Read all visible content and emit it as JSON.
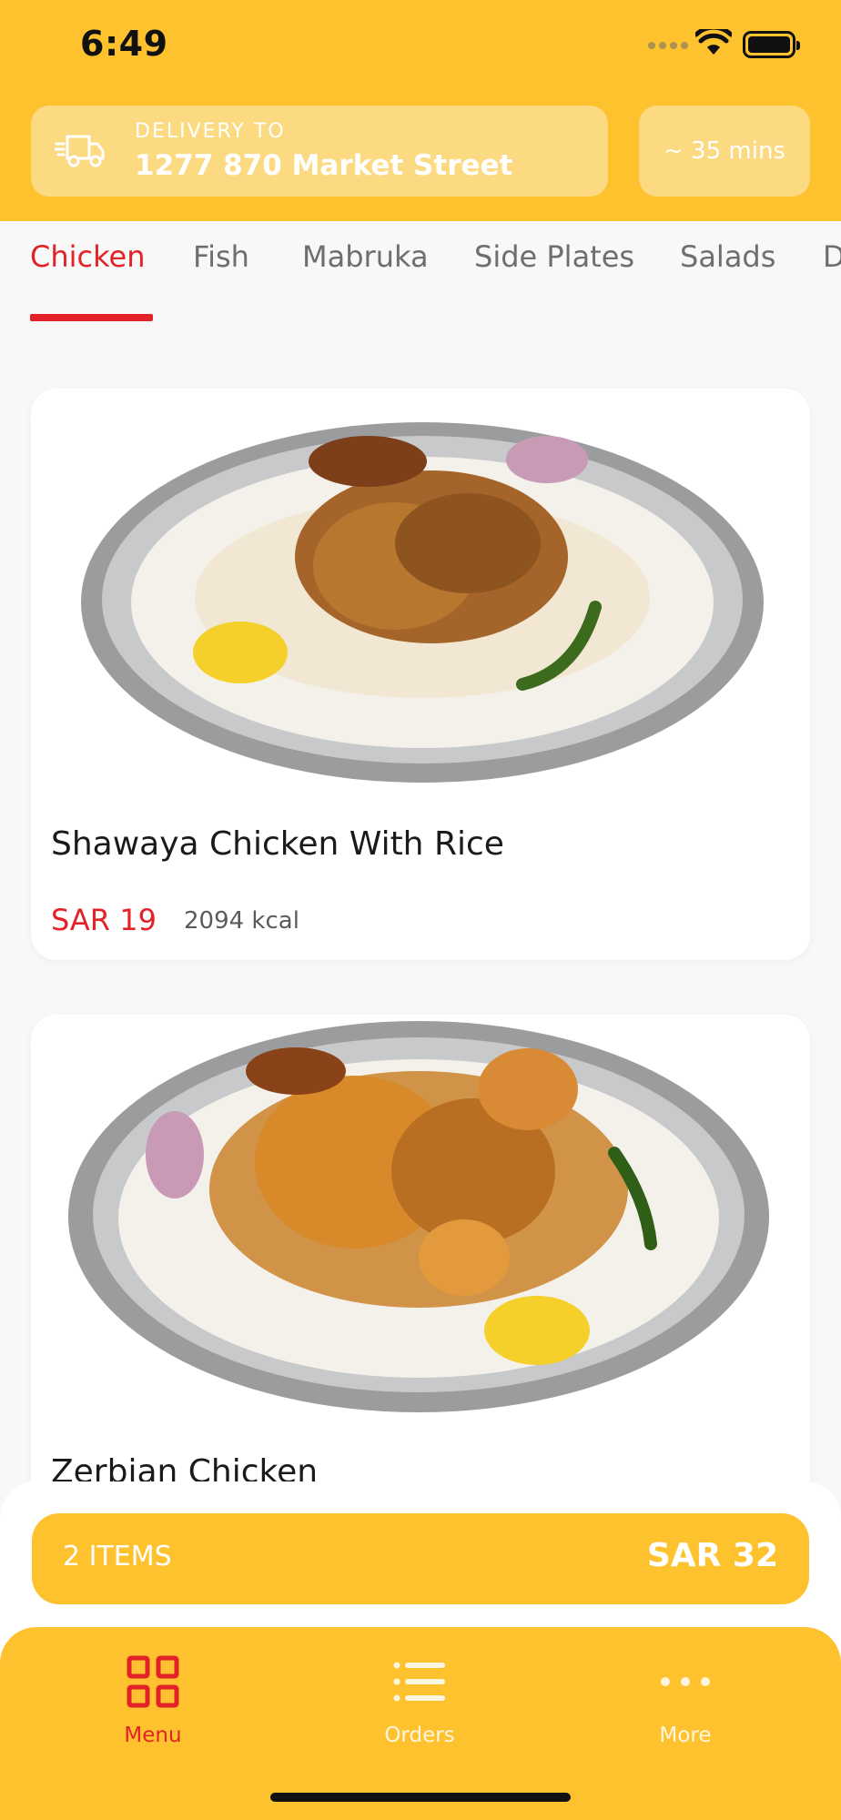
{
  "status_bar": {
    "time": "6:49"
  },
  "header": {
    "delivery_label": "DELIVERY TO",
    "delivery_address": "1277 870 Market Street",
    "eta": "~ 35 mins"
  },
  "tabs": [
    {
      "label": "Chicken",
      "active": true
    },
    {
      "label": "Fish"
    },
    {
      "label": "Mabruka"
    },
    {
      "label": "Side Plates"
    },
    {
      "label": "Salads"
    },
    {
      "label": "D"
    }
  ],
  "menu_items": [
    {
      "name": "Shawaya Chicken With Rice",
      "price": "SAR 19",
      "kcal": "2094 kcal"
    },
    {
      "name": "Zerbian Chicken"
    }
  ],
  "cart": {
    "items": "2 ITEMS",
    "total": "SAR 32"
  },
  "nav": [
    {
      "label": "Menu",
      "icon": "grid-icon",
      "active": true
    },
    {
      "label": "Orders",
      "icon": "list-icon"
    },
    {
      "label": "More",
      "icon": "more-dots-icon"
    }
  ],
  "colors": {
    "brand_yellow": "#FEC22E",
    "accent_red": "#E32227",
    "light_yellow": "#FCDA82"
  }
}
